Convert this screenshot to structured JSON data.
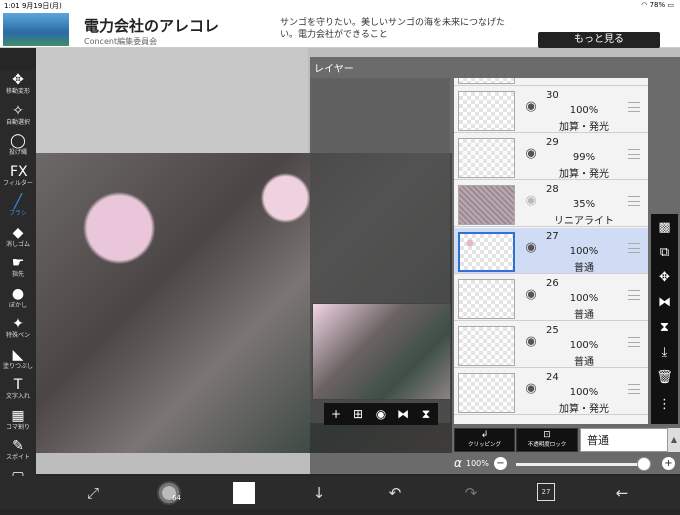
{
  "status": {
    "time": "1:01",
    "date": "9月19日(月)",
    "battery": "78%"
  },
  "ad": {
    "title": "電力会社のアレコレ",
    "subtitle": "Concent編集委員会",
    "description": "サンゴを守りたい。美しいサンゴの海を未来につなげたい。電力会社ができること",
    "button": "もっと見る"
  },
  "tools": [
    {
      "icon": "✥",
      "label": "移動変形"
    },
    {
      "icon": "✧",
      "label": "自動選択"
    },
    {
      "icon": "◯",
      "label": "投げ縄"
    },
    {
      "icon": "FX",
      "label": "フィルター"
    },
    {
      "icon": "╱",
      "label": "ブラシ"
    },
    {
      "icon": "◆",
      "label": "消しゴム"
    },
    {
      "icon": "☛",
      "label": "指先"
    },
    {
      "icon": "●",
      "label": "ぼかし"
    },
    {
      "icon": "✦",
      "label": "特殊ペン"
    },
    {
      "icon": "◣",
      "label": "塗りつぶし"
    },
    {
      "icon": "T",
      "label": "文字入れ"
    },
    {
      "icon": "▦",
      "label": "コマ割り"
    },
    {
      "icon": "✎",
      "label": "スポイト"
    },
    {
      "icon": "▢",
      "label": "キャンバス"
    }
  ],
  "layer_panel": {
    "title": "レイヤー",
    "layers": [
      {
        "number": "30",
        "opacity": "100%",
        "mode": "加算・発光",
        "thumb": "plain"
      },
      {
        "number": "29",
        "opacity": "99%",
        "mode": "加算・発光",
        "thumb": "plain"
      },
      {
        "number": "28",
        "opacity": "35%",
        "mode": "リニアライト",
        "thumb": "texture"
      },
      {
        "number": "27",
        "opacity": "100%",
        "mode": "普通",
        "thumb": "pink"
      },
      {
        "number": "26",
        "opacity": "100%",
        "mode": "普通",
        "thumb": "plain"
      },
      {
        "number": "25",
        "opacity": "100%",
        "mode": "普通",
        "thumb": "plain"
      },
      {
        "number": "24",
        "opacity": "100%",
        "mode": "加算・発光",
        "thumb": "plain"
      }
    ],
    "selected_layer": "27",
    "clipping_label": "クリッピング",
    "alpha_lock_label": "不透明度ロック",
    "blend_mode": "普通",
    "alpha_symbol": "α",
    "alpha_value": "100%",
    "alpha_level": 1.0
  },
  "bottom": {
    "brush_size": "64",
    "layer_count": "27"
  }
}
